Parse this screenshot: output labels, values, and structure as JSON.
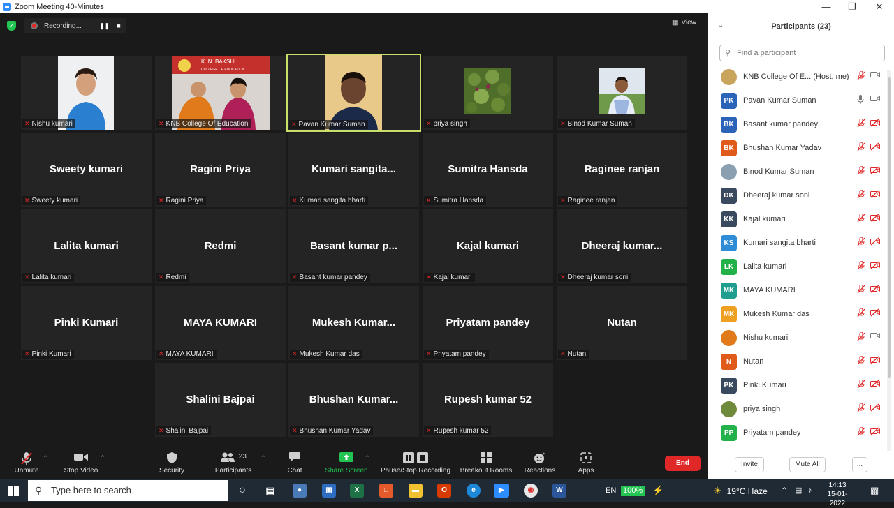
{
  "window": {
    "title": "Zoom Meeting 40-Minutes"
  },
  "recording": {
    "label": "Recording..."
  },
  "view": {
    "label": "View"
  },
  "grid": {
    "tiles": [
      {
        "row": 0,
        "col": 0,
        "big": "",
        "label": "Nishu kumari",
        "photo": "person-blue-hoodie"
      },
      {
        "row": 0,
        "col": 1,
        "big": "",
        "label": "KNB College Of Education",
        "photo": "college-banner"
      },
      {
        "row": 0,
        "col": 2,
        "big": "",
        "label": "Pavan Kumar Suman",
        "photo": "man-video",
        "active": true
      },
      {
        "row": 0,
        "col": 3,
        "big": "",
        "label": "priya singh",
        "photo": "plant"
      },
      {
        "row": 0,
        "col": 4,
        "big": "",
        "label": "Binod Kumar Suman",
        "photo": "man-outdoor"
      },
      {
        "row": 1,
        "col": 0,
        "big": "Sweety kumari",
        "label": "Sweety kumari"
      },
      {
        "row": 1,
        "col": 1,
        "big": "Ragini  Priya",
        "label": "Ragini  Priya"
      },
      {
        "row": 1,
        "col": 2,
        "big": "Kumari  sangita...",
        "label": "Kumari sangita bharti"
      },
      {
        "row": 1,
        "col": 3,
        "big": "Sumitra Hansda",
        "label": "Sumitra Hansda"
      },
      {
        "row": 1,
        "col": 4,
        "big": "Raginee ranjan",
        "label": "Raginee ranjan"
      },
      {
        "row": 2,
        "col": 0,
        "big": "Lalita kumari",
        "label": "Lalita kumari"
      },
      {
        "row": 2,
        "col": 1,
        "big": "Redmi",
        "label": "Redmi"
      },
      {
        "row": 2,
        "col": 2,
        "big": "Basant  kumar  p...",
        "label": "Basant kumar pandey"
      },
      {
        "row": 2,
        "col": 3,
        "big": "Kajal kumari",
        "label": "Kajal kumari"
      },
      {
        "row": 2,
        "col": 4,
        "big": "Dheeraj  kumar...",
        "label": "Dheeraj kumar soni"
      },
      {
        "row": 3,
        "col": 0,
        "big": "Pinki Kumari",
        "label": "Pinki Kumari"
      },
      {
        "row": 3,
        "col": 1,
        "big": "MAYA KUMARI",
        "label": "MAYA KUMARI"
      },
      {
        "row": 3,
        "col": 2,
        "big": "Mukesh  Kumar...",
        "label": "Mukesh Kumar das"
      },
      {
        "row": 3,
        "col": 3,
        "big": "Priyatam pandey",
        "label": "Priyatam pandey"
      },
      {
        "row": 3,
        "col": 4,
        "big": "Nutan",
        "label": "Nutan"
      },
      {
        "row": 4,
        "col": 1,
        "big": "Shalini Bajpai",
        "label": "Shalini Bajpai"
      },
      {
        "row": 4,
        "col": 2,
        "big": "Bhushan  Kumar...",
        "label": "Bhushan Kumar Yadav"
      },
      {
        "row": 4,
        "col": 3,
        "big": "Rupesh kumar 52",
        "label": "Rupesh kumar 52"
      }
    ]
  },
  "toolbar": {
    "unmute": "Unmute",
    "stop_video": "Stop Video",
    "security": "Security",
    "participants": "Participants",
    "participants_count": "23",
    "chat": "Chat",
    "share_screen": "Share Screen",
    "pause_recording": "Pause/Stop Recording",
    "breakout": "Breakout Rooms",
    "reactions": "Reactions",
    "apps": "Apps",
    "end": "End"
  },
  "panel": {
    "title": "Participants (23)",
    "search_placeholder": "Find a participant",
    "invite": "Invite",
    "mute_all": "Mute All",
    "more": "...",
    "participants": [
      {
        "initials": "",
        "name": "KNB College Of E...  (Host, me)",
        "color": "#c9a45c",
        "mic": "off",
        "cam": "on",
        "img": true
      },
      {
        "initials": "PK",
        "name": "Pavan Kumar Suman",
        "color": "#2a63b8",
        "mic": "on",
        "cam": "on"
      },
      {
        "initials": "BK",
        "name": "Basant kumar pandey",
        "color": "#2a63b8",
        "mic": "off",
        "cam": "off"
      },
      {
        "initials": "BK",
        "name": "Bhushan Kumar Yadav",
        "color": "#e05a1a",
        "mic": "off",
        "cam": "off"
      },
      {
        "initials": "",
        "name": "Binod Kumar Suman",
        "color": "#8aa0b0",
        "mic": "off",
        "cam": "off",
        "img": true
      },
      {
        "initials": "DK",
        "name": "Dheeraj kumar soni",
        "color": "#3a4a5e",
        "mic": "off",
        "cam": "off"
      },
      {
        "initials": "KK",
        "name": "Kajal kumari",
        "color": "#3a4a5e",
        "mic": "off",
        "cam": "off"
      },
      {
        "initials": "KS",
        "name": "Kumari sangita bharti",
        "color": "#2e8bd6",
        "mic": "off",
        "cam": "off"
      },
      {
        "initials": "LK",
        "name": "Lalita kumari",
        "color": "#23b24a",
        "mic": "off",
        "cam": "off"
      },
      {
        "initials": "MK",
        "name": "MAYA KUMARI",
        "color": "#1f9e8f",
        "mic": "off",
        "cam": "off"
      },
      {
        "initials": "MK",
        "name": "Mukesh Kumar das",
        "color": "#f0a020",
        "mic": "off",
        "cam": "off"
      },
      {
        "initials": "",
        "name": "Nishu kumari",
        "color": "#e07a1a",
        "mic": "off",
        "cam": "on",
        "img": true
      },
      {
        "initials": "N",
        "name": "Nutan",
        "color": "#e05a1a",
        "mic": "off",
        "cam": "off"
      },
      {
        "initials": "PK",
        "name": "Pinki Kumari",
        "color": "#3a4a5e",
        "mic": "off",
        "cam": "off"
      },
      {
        "initials": "",
        "name": "priya singh",
        "color": "#6f8a3a",
        "mic": "off",
        "cam": "off",
        "img": true
      },
      {
        "initials": "PP",
        "name": "Priyatam pandey",
        "color": "#23b24a",
        "mic": "off",
        "cam": "off"
      }
    ]
  },
  "taskbar": {
    "search_placeholder": "Type here to search",
    "lang": "EN",
    "battery": "100%",
    "weather": "19°C  Haze",
    "time": "14:13",
    "date": "15-01-2022"
  },
  "colors": {
    "accent_green": "#23c552",
    "end_red": "#e02828",
    "active_border": "#c8e06a"
  }
}
